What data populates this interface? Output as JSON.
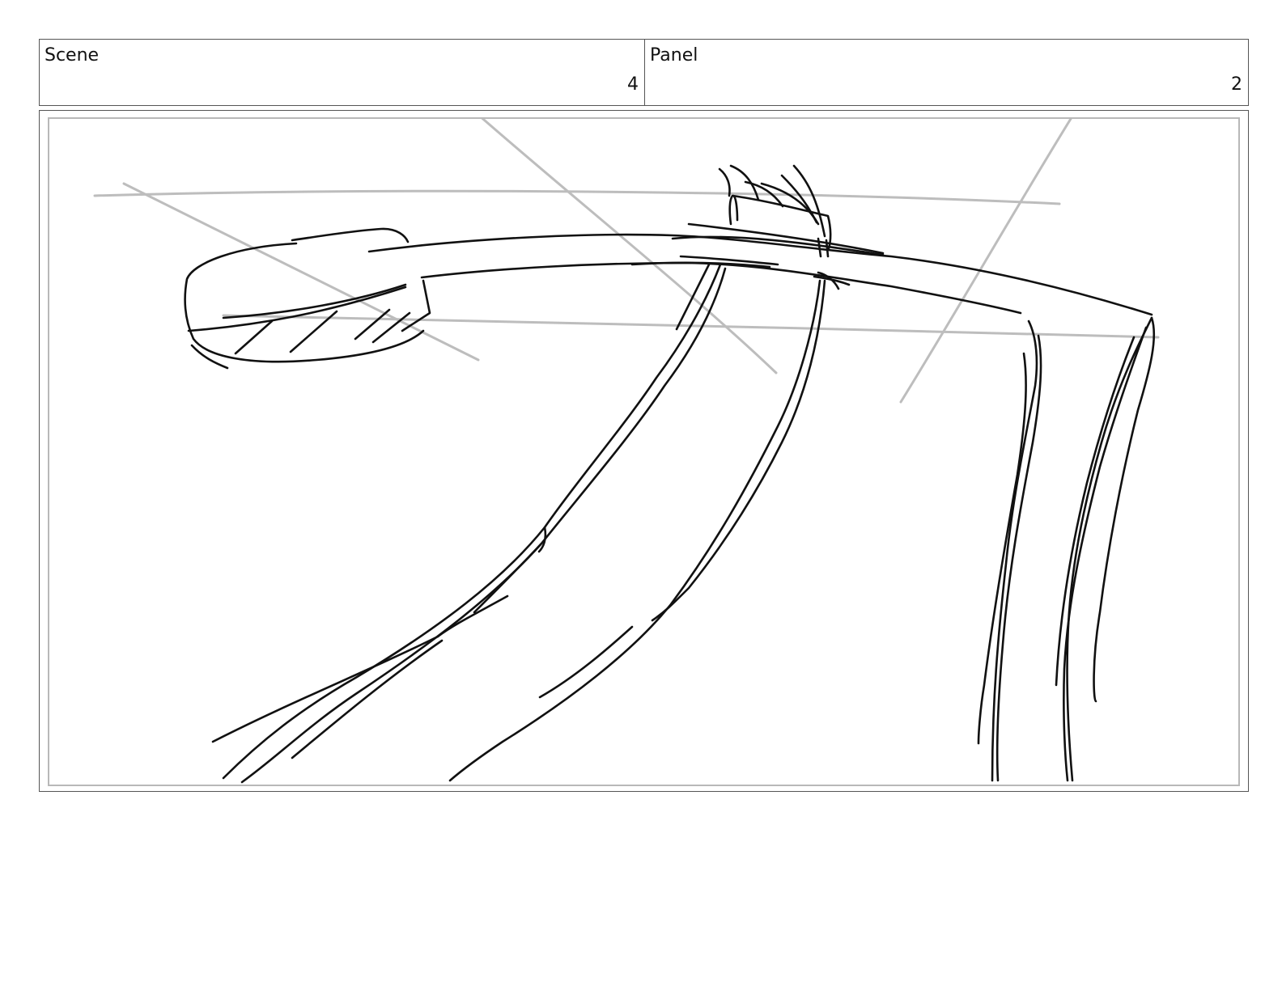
{
  "header": {
    "scene_label": "Scene",
    "scene_value": "4",
    "panel_label": "Panel",
    "panel_value": "2"
  },
  "colors": {
    "frame_border": "#555555",
    "inner_border": "#b8b8b8",
    "construction_lines": "#bdbdbd",
    "ink": "#111111"
  }
}
